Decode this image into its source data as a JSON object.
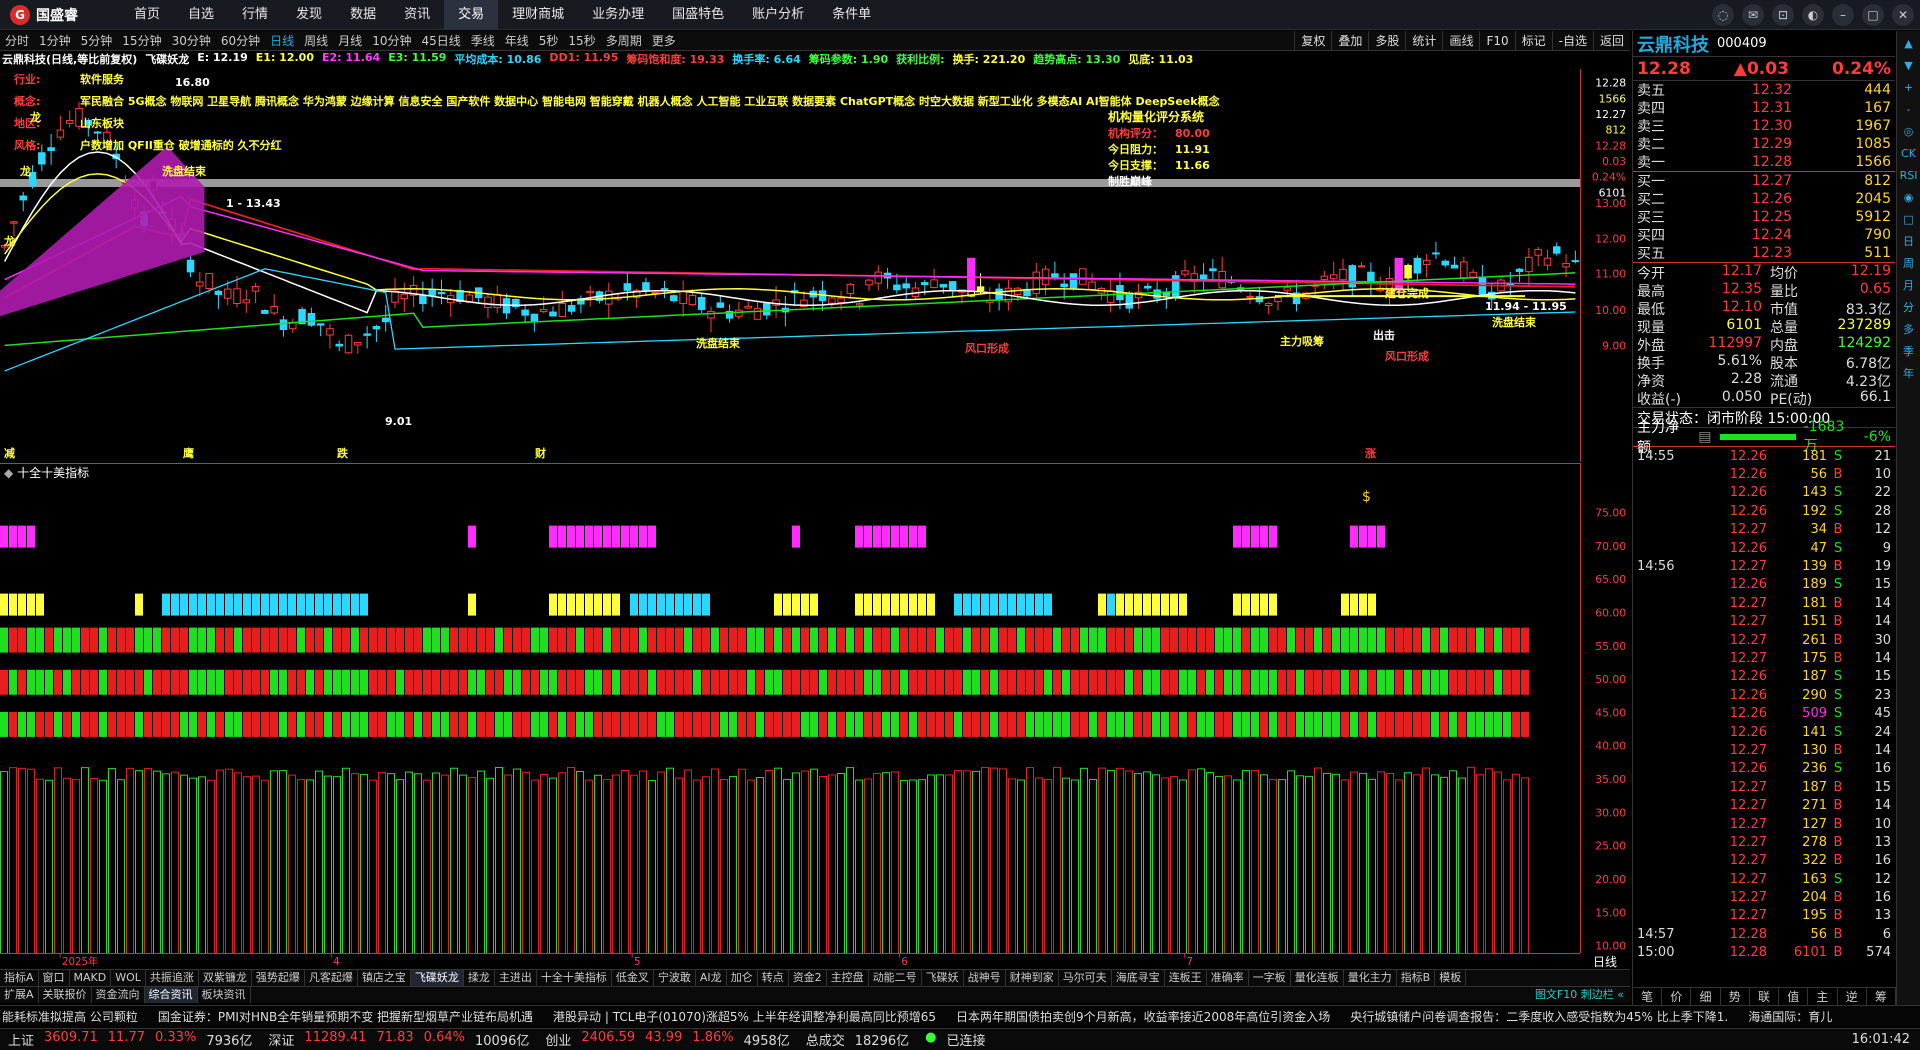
{
  "app": {
    "logo_text": "国盛睿",
    "nav": [
      "首页",
      "自选",
      "行情",
      "发现",
      "数据",
      "资讯",
      "交易",
      "理财商城",
      "业务办理",
      "国盛特色",
      "账户分析",
      "条件单"
    ],
    "nav_active_index": 6
  },
  "periods": [
    "分时",
    "1分钟",
    "5分钟",
    "15分钟",
    "30分钟",
    "60分钟",
    "日线",
    "周线",
    "月线",
    "10分钟",
    "45日线",
    "季线",
    "年线",
    "5秒",
    "15秒",
    "多周期",
    "更多"
  ],
  "period_active_index": 6,
  "chart_tools": [
    "复权",
    "叠加",
    "多股",
    "统计",
    "画线",
    "F10",
    "标记",
    "-自选",
    "返回"
  ],
  "indicators": [
    {
      "text": "云鼎科技(日线,等比前复权)",
      "color": "#ffffff"
    },
    {
      "text": "飞碟妖龙",
      "color": "#ffffff"
    },
    {
      "text": "E: 12.19",
      "color": "#ffffff"
    },
    {
      "text": "E1: 12.00",
      "color": "#ffff3b"
    },
    {
      "text": "E2: 11.64",
      "color": "#ff3bff"
    },
    {
      "text": "E3: 11.59",
      "color": "#3bff3b"
    },
    {
      "text": "平均成本: 10.86",
      "color": "#2ad8ff"
    },
    {
      "text": "DD1: 11.95",
      "color": "#ff3b3b"
    },
    {
      "text": "筹码饱和度: 19.33",
      "color": "#ff3b3b"
    },
    {
      "text": "换手率: 6.64",
      "color": "#2ad8ff"
    },
    {
      "text": "筹码参数: 1.90",
      "color": "#3bff3b"
    },
    {
      "text": "获利比例:",
      "color": "#3bff3b"
    },
    {
      "text": "换手: 221.20",
      "color": "#ffff3b"
    },
    {
      "text": "趋势高点: 13.30",
      "color": "#3bff3b"
    },
    {
      "text": "见底: 11.03",
      "color": "#ffff3b"
    }
  ],
  "annotations": {
    "industry_label": "行业:",
    "industry_value": "软件服务",
    "concept_label": "概念:",
    "concepts": "军民融合 5G概念 物联网 卫星导航 腾讯概念 华为鸿蒙 边缘计算 信息安全 国产软件 数据中心 智能电网 智能穿戴 机器人概念 人工智能 工业互联 数据要素 ChatGPT概念 时空大数据 新型工业化 多模态AI AI智能体 DeepSeek概念",
    "region_label": "地区:",
    "region_value": "山东板块",
    "style_label": "风格:",
    "style_value": "户数增加 QFII重仓 破增通标的 久不分红",
    "dragon1": "龙",
    "dragon2": "龙",
    "dragon3": "龙",
    "high_label": "16.80",
    "low_label": "9.01",
    "line_label": "1 - 13.43",
    "range_label": "11.94 - 11.95",
    "wash1": "洗盘结束",
    "wash2": "洗盘结束",
    "wash3": "洗盘结束",
    "wind1": "风口形成",
    "wind2": "风口形成",
    "chips": "主力吸筹",
    "complete": "建仓完成",
    "out": "出击",
    "m_ying": "鹰",
    "m_die": "跌",
    "m_cai": "财",
    "m_zhang": "涨",
    "m_jian": "减",
    "rating_title": "机构量化评分系统",
    "rating_score_label": "机构评分：",
    "rating_score": "80.00",
    "resist_label": "今日阻力：",
    "resist_value": "11.91",
    "support_label": "今日支撑：",
    "support_value": "11.66",
    "win_label": "制胜巅峰"
  },
  "price_axis": [
    "13.00",
    "12.00",
    "11.00",
    "10.00",
    "9.00"
  ],
  "price_axis_top": [
    {
      "v": "12.28",
      "c": "#ffffff"
    },
    {
      "v": "1566",
      "c": "#ffff3b"
    },
    {
      "v": "12.27",
      "c": "#ffffff"
    },
    {
      "v": "812",
      "c": "#ffff3b"
    },
    {
      "v": "12.28",
      "c": "#ff3b3b"
    },
    {
      "v": "0.03",
      "c": "#ff3b3b"
    },
    {
      "v": "0.24%",
      "c": "#ff3b3b"
    },
    {
      "v": "6101",
      "c": "#ffffff"
    }
  ],
  "sub_title": "十全十美指标",
  "sub_axis": [
    "75.00",
    "70.00",
    "65.00",
    "60.00",
    "55.00",
    "50.00",
    "45.00",
    "40.00",
    "35.00",
    "30.00",
    "25.00",
    "20.00",
    "15.00",
    "10.00"
  ],
  "dates": [
    "2025年",
    "4",
    "5",
    "6",
    "7"
  ],
  "date_right": "日线",
  "bottom_tabs1": [
    "指标A",
    "窗口",
    "MAKD",
    "WOL",
    "共振追涨",
    "双紫镰龙",
    "强势起爆",
    "凡客起爆",
    "镇店之宝",
    "飞碟妖龙",
    "揉龙",
    "主进出",
    "十全十美指标",
    "低金叉",
    "宁波敢",
    "AI龙",
    "加仑",
    "转点",
    "资金2",
    "主控盘",
    "动能二号",
    "飞碟妖",
    "战神号",
    "财神到家",
    "马尔可夫",
    "海底寻宝",
    "连板王",
    "准确率",
    "一字板",
    "量化连板",
    "量化主力",
    "指标B",
    "模板"
  ],
  "bottom_tabs1_active": 9,
  "bottom_tabs2": [
    "扩展A",
    "关联报价",
    "资金流向",
    "综合资讯",
    "板块资讯"
  ],
  "bottom_tabs2_active": 3,
  "bottom_tabs2_right": "图文F10 刺边栏 «",
  "news": [
    "能耗标准拟提高 公司颗粒",
    "国金证券：PMI对HNB全年销量预期不变 把握新型烟草产业链布局机遇",
    "港股异动 | TCL电子(01070)涨超5% 上半年经调整净利最高同比预增65",
    "日本两年期国债拍卖创9个月新高，收益率接近2008年高位引资金入场",
    "央行城镇储户问卷调查报告：二季度收入感受指数为45% 比上季下降1.",
    "海通国际：育儿"
  ],
  "status": {
    "sh_label": "上证",
    "sh_value": "3609.71",
    "sh_chg": "11.77",
    "sh_pct": "0.33%",
    "sh_amt": "7936亿",
    "sz_label": "深证",
    "sz_value": "11289.41",
    "sz_chg": "71.83",
    "sz_pct": "0.64%",
    "sz_amt": "10096亿",
    "cy_label": "创业",
    "cy_value": "2406.59",
    "cy_chg": "43.99",
    "cy_pct": "1.86%",
    "cy_amt": "4958亿",
    "total_label": "总成交",
    "total_value": "18296亿",
    "conn": "已连接",
    "time": "16:01:42"
  },
  "stock": {
    "name": "云鼎科技",
    "code": "000409",
    "price": "12.28",
    "change": "▲0.03",
    "pct": "0.24%"
  },
  "asks": [
    {
      "label": "卖五",
      "price": "12.32",
      "vol": "444"
    },
    {
      "label": "卖四",
      "price": "12.31",
      "vol": "167"
    },
    {
      "label": "卖三",
      "price": "12.30",
      "vol": "1967"
    },
    {
      "label": "卖二",
      "price": "12.29",
      "vol": "1085"
    },
    {
      "label": "卖一",
      "price": "12.28",
      "vol": "1566"
    }
  ],
  "bids": [
    {
      "label": "买一",
      "price": "12.27",
      "vol": "812"
    },
    {
      "label": "买二",
      "price": "12.26",
      "vol": "2045"
    },
    {
      "label": "买三",
      "price": "12.25",
      "vol": "5912"
    },
    {
      "label": "买四",
      "price": "12.24",
      "vol": "790"
    },
    {
      "label": "买五",
      "price": "12.23",
      "vol": "511"
    }
  ],
  "stats": [
    {
      "k1": "今开",
      "v1": "12.17",
      "k2": "均价",
      "v2": "12.19",
      "c1": "#ff3b3b",
      "c2": "#ff3b3b"
    },
    {
      "k1": "最高",
      "v1": "12.35",
      "k2": "量比",
      "v2": "0.65",
      "c1": "#ff3b3b",
      "c2": "#ff3b3b"
    },
    {
      "k1": "最低",
      "v1": "12.10",
      "k2": "市值",
      "v2": "83.3亿",
      "c1": "#ff3b3b",
      "c2": "#dddddd"
    },
    {
      "k1": "现量",
      "v1": "6101",
      "k2": "总量",
      "v2": "237289",
      "c1": "#ffff3b",
      "c2": "#ffff3b"
    },
    {
      "k1": "外盘",
      "v1": "112997",
      "k2": "内盘",
      "v2": "124292",
      "c1": "#ff3b3b",
      "c2": "#3bff3b"
    },
    {
      "k1": "换手",
      "v1": "5.61%",
      "k2": "股本",
      "v2": "6.78亿",
      "c1": "#dddddd",
      "c2": "#dddddd"
    },
    {
      "k1": "净资",
      "v1": "2.28",
      "k2": "流通",
      "v2": "4.23亿",
      "c1": "#dddddd",
      "c2": "#dddddd"
    },
    {
      "k1": "收益(-)",
      "v1": "0.050",
      "k2": "PE(动)",
      "v2": "66.1",
      "c1": "#dddddd",
      "c2": "#dddddd"
    }
  ],
  "trade_state": "交易状态：闭市阶段 15:00:00",
  "main_flow_label": "主力净额",
  "main_flow_value": "-1683万",
  "main_flow_pct": "-6%",
  "ticks": [
    {
      "t": "14:55",
      "p": "12.26",
      "v": "181",
      "s": "S",
      "n": "21"
    },
    {
      "t": "",
      "p": "12.26",
      "v": "56",
      "s": "B",
      "n": "10"
    },
    {
      "t": "",
      "p": "12.26",
      "v": "143",
      "s": "S",
      "n": "22"
    },
    {
      "t": "",
      "p": "12.26",
      "v": "192",
      "s": "S",
      "n": "28"
    },
    {
      "t": "",
      "p": "12.27",
      "v": "34",
      "s": "B",
      "n": "12"
    },
    {
      "t": "",
      "p": "12.26",
      "v": "47",
      "s": "S",
      "n": "9"
    },
    {
      "t": "14:56",
      "p": "12.27",
      "v": "139",
      "s": "B",
      "n": "19"
    },
    {
      "t": "",
      "p": "12.26",
      "v": "189",
      "s": "S",
      "n": "15"
    },
    {
      "t": "",
      "p": "12.27",
      "v": "181",
      "s": "B",
      "n": "14"
    },
    {
      "t": "",
      "p": "12.27",
      "v": "151",
      "s": "B",
      "n": "14"
    },
    {
      "t": "",
      "p": "12.27",
      "v": "261",
      "s": "B",
      "n": "30"
    },
    {
      "t": "",
      "p": "12.27",
      "v": "175",
      "s": "B",
      "n": "14"
    },
    {
      "t": "",
      "p": "12.26",
      "v": "187",
      "s": "S",
      "n": "15"
    },
    {
      "t": "",
      "p": "12.26",
      "v": "290",
      "s": "S",
      "n": "23"
    },
    {
      "t": "",
      "p": "12.26",
      "v": "509",
      "s": "S",
      "n": "45"
    },
    {
      "t": "",
      "p": "12.26",
      "v": "141",
      "s": "S",
      "n": "24"
    },
    {
      "t": "",
      "p": "12.27",
      "v": "130",
      "s": "B",
      "n": "14"
    },
    {
      "t": "",
      "p": "12.26",
      "v": "236",
      "s": "S",
      "n": "16"
    },
    {
      "t": "",
      "p": "12.27",
      "v": "187",
      "s": "B",
      "n": "15"
    },
    {
      "t": "",
      "p": "12.27",
      "v": "271",
      "s": "B",
      "n": "14"
    },
    {
      "t": "",
      "p": "12.27",
      "v": "127",
      "s": "B",
      "n": "10"
    },
    {
      "t": "",
      "p": "12.27",
      "v": "278",
      "s": "B",
      "n": "13"
    },
    {
      "t": "",
      "p": "12.27",
      "v": "322",
      "s": "B",
      "n": "16"
    },
    {
      "t": "",
      "p": "12.27",
      "v": "163",
      "s": "S",
      "n": "12"
    },
    {
      "t": "",
      "p": "12.27",
      "v": "204",
      "s": "B",
      "n": "16"
    },
    {
      "t": "",
      "p": "12.27",
      "v": "195",
      "s": "B",
      "n": "13"
    },
    {
      "t": "14:57",
      "p": "12.28",
      "v": "56",
      "s": "B",
      "n": "6"
    },
    {
      "t": "15:00",
      "p": "12.28",
      "v": "6101",
      "s": "B",
      "n": "574"
    }
  ],
  "rp_tabs": [
    "笔",
    "价",
    "细",
    "势",
    "联",
    "值",
    "主",
    "逆",
    "筹"
  ],
  "sidebar_icons": [
    "▲",
    "▼",
    "+",
    "-",
    "◎",
    "CK",
    "RSI",
    "◉",
    "□",
    "日",
    "周",
    "月",
    "分",
    "多",
    "季",
    "年"
  ],
  "colors": {
    "up": "#ff3b3b",
    "down": "#1ee01e",
    "cyan": "#2ad8ff",
    "yellow": "#ffff3b",
    "magenta": "#ff2bff",
    "white": "#ffffff"
  }
}
